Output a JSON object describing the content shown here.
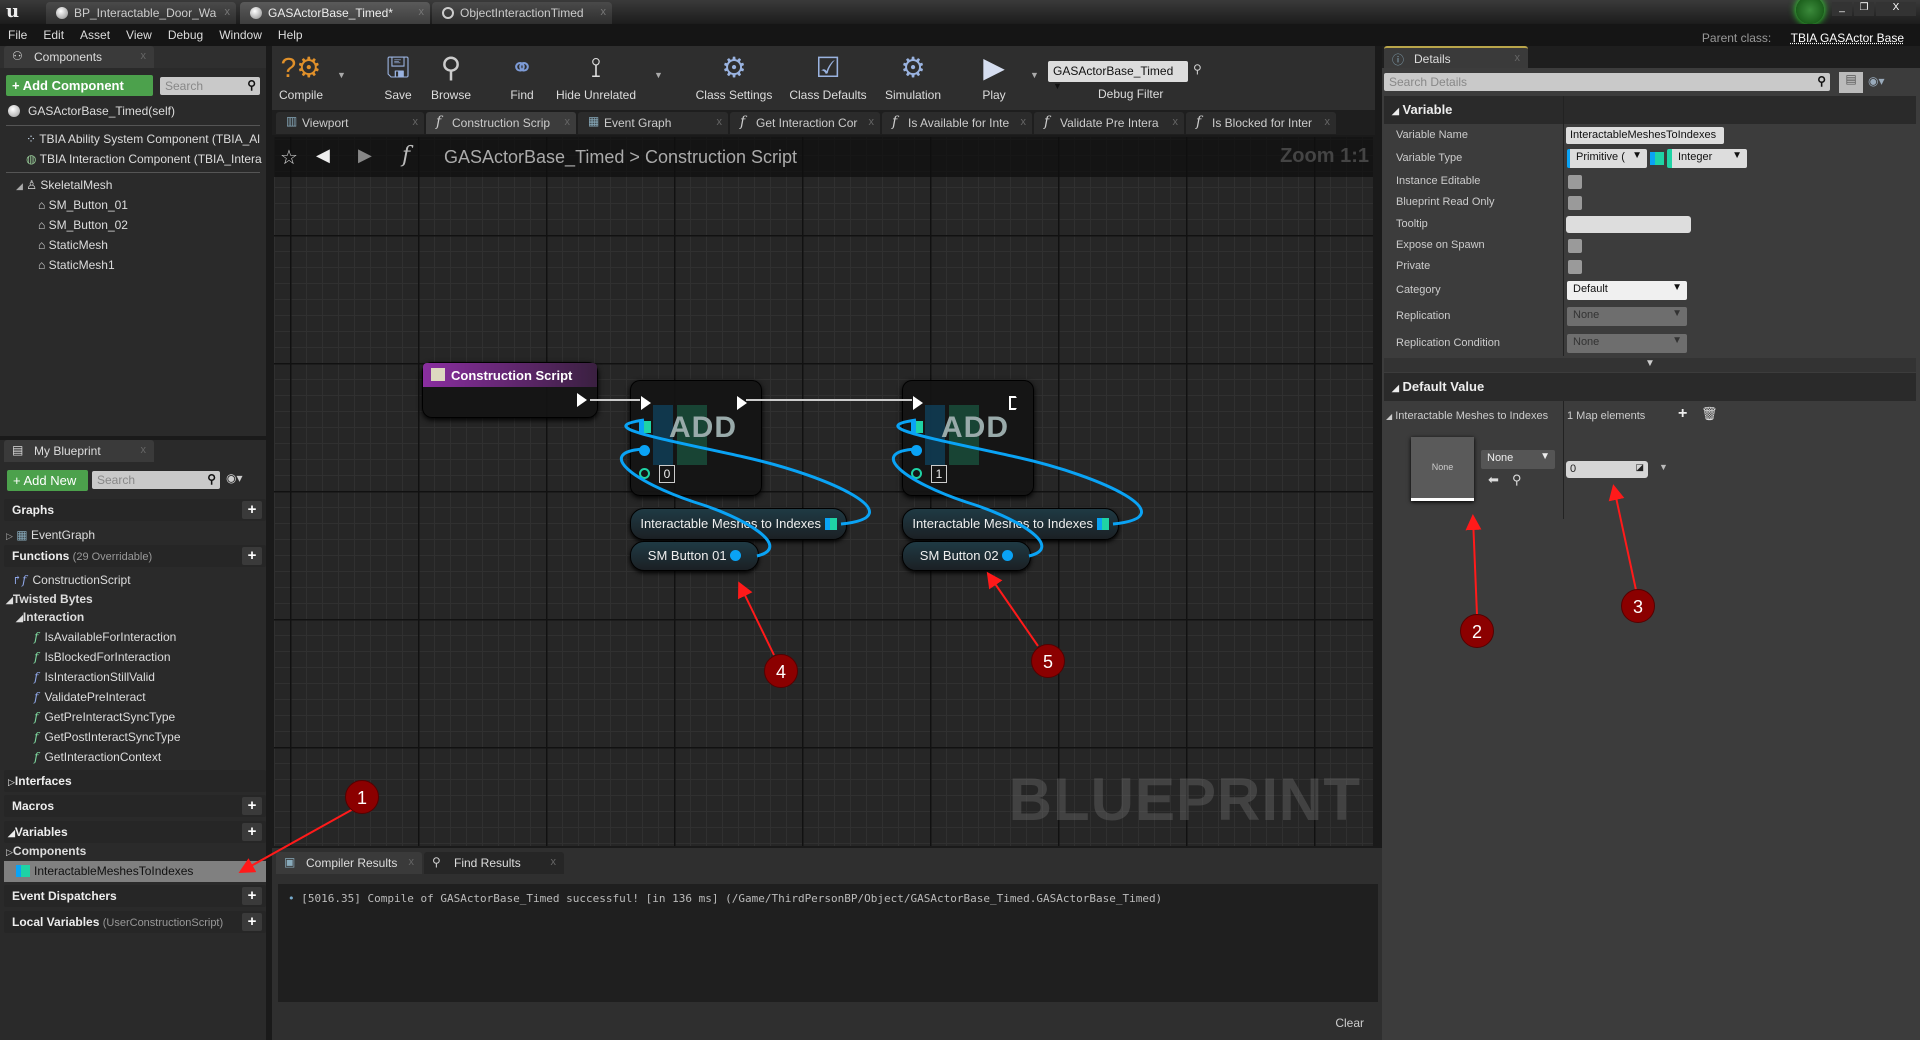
{
  "title_bar": {
    "tabs": [
      {
        "label": "BP_Interactable_Door_Wa"
      },
      {
        "label": "GASActorBase_Timed*"
      },
      {
        "label": "ObjectInteractionTimed"
      }
    ]
  },
  "menu": [
    "File",
    "Edit",
    "Asset",
    "View",
    "Debug",
    "Window",
    "Help"
  ],
  "parent_class": {
    "label": "Parent class:",
    "value": "TBIA GASActor Base"
  },
  "components": {
    "tab": "Components",
    "add_label": "+ Add Component",
    "search_placeholder": "Search",
    "root": "GASActorBase_Timed(self)",
    "items": [
      "TBIA Ability System Component (TBIA_Al",
      "TBIA Interaction Component (TBIA_Intera",
      "SkeletalMesh",
      "SM_Button_01",
      "SM_Button_02",
      "StaticMesh",
      "StaticMesh1"
    ]
  },
  "my_blueprint": {
    "tab": "My Blueprint",
    "add_label": "+ Add New",
    "search_placeholder": "Search",
    "graphs": "Graphs",
    "event_graph": "EventGraph",
    "functions": "Functions",
    "functions_sub": "(29 Overridable)",
    "construction_script": "ConstructionScript",
    "twisted_bytes": "Twisted Bytes",
    "interaction": "Interaction",
    "function_items": [
      {
        "label": "IsAvailableForInteraction",
        "color": "green"
      },
      {
        "label": "IsBlockedForInteraction",
        "color": "green"
      },
      {
        "label": "IsInteractionStillValid",
        "color": "blue"
      },
      {
        "label": "ValidatePreInteract",
        "color": "blue"
      },
      {
        "label": "GetPreInteractSyncType",
        "color": "green"
      },
      {
        "label": "GetPostInteractSyncType",
        "color": "green"
      },
      {
        "label": "GetInteractionContext",
        "color": "green"
      }
    ],
    "interfaces": "Interfaces",
    "macros": "Macros",
    "variables": "Variables",
    "components": "Components",
    "selected_variable": "InteractableMeshesToIndexes",
    "event_dispatchers": "Event Dispatchers",
    "local_variables": "Local Variables",
    "local_variables_sub": "(UserConstructionScript)"
  },
  "toolbar": {
    "compile": "Compile",
    "save": "Save",
    "browse": "Browse",
    "find": "Find",
    "hide_unrelated": "Hide Unrelated",
    "class_settings": "Class Settings",
    "class_defaults": "Class Defaults",
    "simulation": "Simulation",
    "play": "Play",
    "debug_object": "GASActorBase_Timed",
    "debug_filter": "Debug Filter"
  },
  "graph_tabs": [
    {
      "label": "Viewport"
    },
    {
      "label": "Construction Scrip"
    },
    {
      "label": "Event Graph"
    },
    {
      "label": "Get Interaction Cor"
    },
    {
      "label": "Is Available for Inte"
    },
    {
      "label": "Validate Pre Intera"
    },
    {
      "label": "Is Blocked for Inter"
    }
  ],
  "breadcrumb": {
    "blueprint": "GASActorBase_Timed",
    "separator": ">",
    "graph": "Construction Script"
  },
  "graph": {
    "zoom": "Zoom 1:1",
    "watermark": "BLUEPRINT",
    "construction_node": "Construction Script",
    "add_nodes": [
      {
        "label": "ADD",
        "index": "0",
        "map_var": "Interactable Meshes to Indexes",
        "key_var": "SM Button 01"
      },
      {
        "label": "ADD",
        "index": "1",
        "map_var": "Interactable Meshes to Indexes",
        "key_var": "SM Button 02"
      }
    ],
    "wire_color": "#0aa3f5",
    "exec_color": "#ffffff"
  },
  "bottom": {
    "tabs": [
      "Compiler Results",
      "Find Results"
    ],
    "log": "[5016.35] Compile of GASActorBase_Timed successful! [in 136 ms] (/Game/ThirdPersonBP/Object/GASActorBase_Timed.GASActorBase_Timed)",
    "clear": "Clear"
  },
  "details": {
    "tab": "Details",
    "search_placeholder": "Search Details",
    "variable_section": "Variable",
    "rows": {
      "variable_name": {
        "label": "Variable Name",
        "value": "InteractableMeshesToIndexes"
      },
      "variable_type": {
        "label": "Variable Type",
        "key_type": "Primitive (",
        "value_type": "Integer"
      },
      "instance_editable": {
        "label": "Instance Editable",
        "checked": false
      },
      "blueprint_read_only": {
        "label": "Blueprint Read Only",
        "checked": false
      },
      "tooltip": {
        "label": "Tooltip",
        "value": ""
      },
      "expose_on_spawn": {
        "label": "Expose on Spawn",
        "checked": false
      },
      "private": {
        "label": "Private",
        "checked": false
      },
      "category": {
        "label": "Category",
        "value": "Default"
      },
      "replication": {
        "label": "Replication",
        "value": "None"
      },
      "replication_condition": {
        "label": "Replication Condition",
        "value": "None"
      }
    },
    "default_section": "Default Value",
    "map_label": "Interactable Meshes to Indexes",
    "map_count": "1 Map elements",
    "key_thumbnail": "None",
    "key_value": "None",
    "int_value": "0"
  },
  "annotations": [
    "1",
    "2",
    "3",
    "4",
    "5"
  ],
  "colors": {
    "accent_green": "#4ca14c",
    "annotation_red": "#8b0000",
    "arrow_red": "#ff1a1a",
    "map_teal": "#1fd3a5",
    "pin_blue": "#0aa3f5"
  }
}
